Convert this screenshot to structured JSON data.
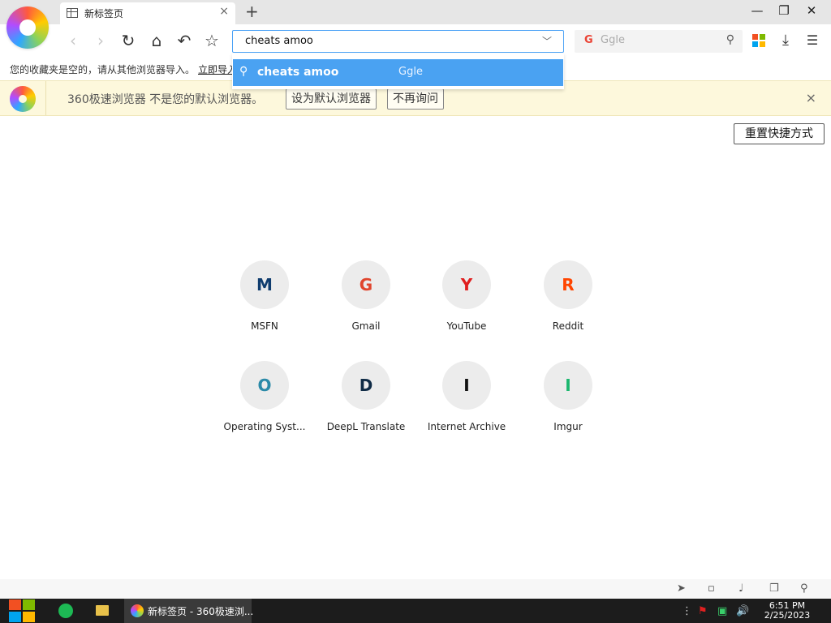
{
  "tab": {
    "title": "新标签页",
    "close": "×",
    "new": "+"
  },
  "window": {
    "minimize": "—",
    "restore": "❐",
    "close": "✕"
  },
  "toolbar": {
    "back": "‹",
    "forward": "›",
    "reload": "↻",
    "home": "⌂",
    "undo": "↶",
    "star": "☆",
    "address_value": "cheats amoo",
    "address_caret": "﹀",
    "search_engine_logo": "G",
    "search_placeholder": "Ggle",
    "search_icon": "⚲",
    "download_icon": "⤓",
    "menu_icon": "☰"
  },
  "bookmarks": {
    "message": "您的收藏夹是空的，请从其他浏览器导入。",
    "import_link": "立即导入"
  },
  "suggest": {
    "icon": "🔍",
    "text": "cheats amoo",
    "source": "Ggle"
  },
  "infobar": {
    "text": "360极速浏览器 不是您的默认浏览器。",
    "set_default": "设为默认浏览器",
    "dont_ask": "不再询问",
    "close": "×"
  },
  "reset_shortcuts": "重置快捷方式",
  "shortcuts": [
    {
      "letter": "M",
      "label": "MSFN",
      "color": "#0f3c6e"
    },
    {
      "letter": "G",
      "label": "Gmail",
      "color": "#e0452d"
    },
    {
      "letter": "Y",
      "label": "YouTube",
      "color": "#e01e1e"
    },
    {
      "letter": "R",
      "label": "Reddit",
      "color": "#ff4500"
    },
    {
      "letter": "O",
      "label": "Operating Syst...",
      "color": "#2b8aa8"
    },
    {
      "letter": "D",
      "label": "DeepL Translate",
      "color": "#0f2b46"
    },
    {
      "letter": "I",
      "label": "Internet Archive",
      "color": "#111111"
    },
    {
      "letter": "I",
      "label": "Imgur",
      "color": "#1bb76e"
    }
  ],
  "bottom_icons": [
    "rocket-icon",
    "trash-icon",
    "speaker-icon",
    "window-icon",
    "search-icon"
  ],
  "taskbar": {
    "active_title": "新标签页 - 360极速浏...",
    "time": "6:51 PM",
    "date": "2/25/2023"
  }
}
